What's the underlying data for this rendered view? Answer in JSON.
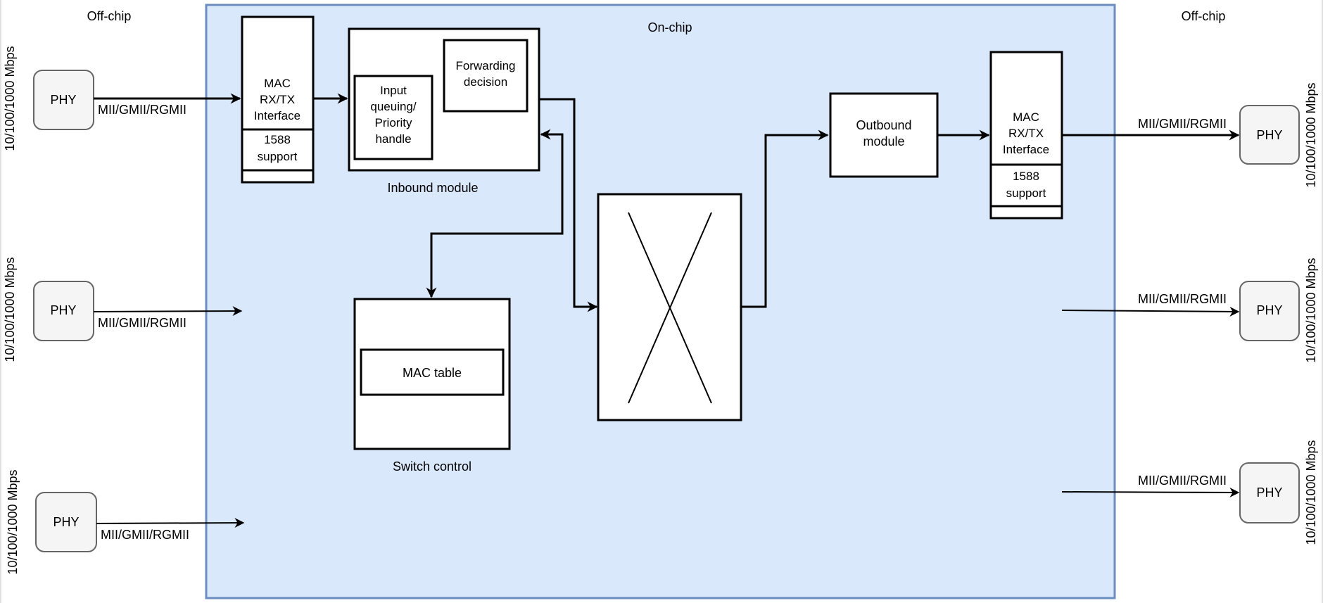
{
  "labels": {
    "off_chip_left": "Off-chip",
    "off_chip_right": "Off-chip",
    "on_chip": "On-chip",
    "interface": "MII/GMII/RGMII",
    "speed": "10/100/1000 Mbps",
    "phy": "PHY"
  },
  "left_ports": [
    {
      "phy": "PHY",
      "interface": "MII/GMII/RGMII",
      "speed": "10/100/1000 Mbps"
    },
    {
      "phy": "PHY",
      "interface": "MII/GMII/RGMII",
      "speed": "10/100/1000 Mbps"
    },
    {
      "phy": "PHY",
      "interface": "MII/GMII/RGMII",
      "speed": "10/100/1000 Mbps"
    }
  ],
  "right_ports": [
    {
      "phy": "PHY",
      "interface": "MII/GMII/RGMII",
      "speed": "10/100/1000 Mbps"
    },
    {
      "phy": "PHY",
      "interface": "MII/GMII/RGMII",
      "speed": "10/100/1000 Mbps"
    },
    {
      "phy": "PHY",
      "interface": "MII/GMII/RGMII",
      "speed": "10/100/1000 Mbps"
    }
  ],
  "mac_in": {
    "lines": [
      "MAC",
      "RX/TX",
      "Interface"
    ],
    "sub_lines": [
      "1588",
      "support"
    ]
  },
  "mac_out": {
    "lines": [
      "MAC",
      "RX/TX",
      "Interface"
    ],
    "sub_lines": [
      "1588",
      "support"
    ]
  },
  "inbound": {
    "label": "Inbound module",
    "input_queuing": [
      "Input",
      "queuing/",
      "Priority",
      "handle"
    ],
    "forwarding": [
      "Forwarding",
      "decision"
    ]
  },
  "switch_control": {
    "label": "Switch control",
    "mac_table": "MAC table"
  },
  "outbound": {
    "lines": [
      "Outbound",
      "module"
    ]
  },
  "crossbar": {
    "name": "Switch fabric crossbar"
  },
  "colors": {
    "chip_fill": "#dae8fc",
    "chip_border": "#6c8ebf",
    "phy_fill": "#f5f5f5",
    "phy_border": "#666666"
  }
}
